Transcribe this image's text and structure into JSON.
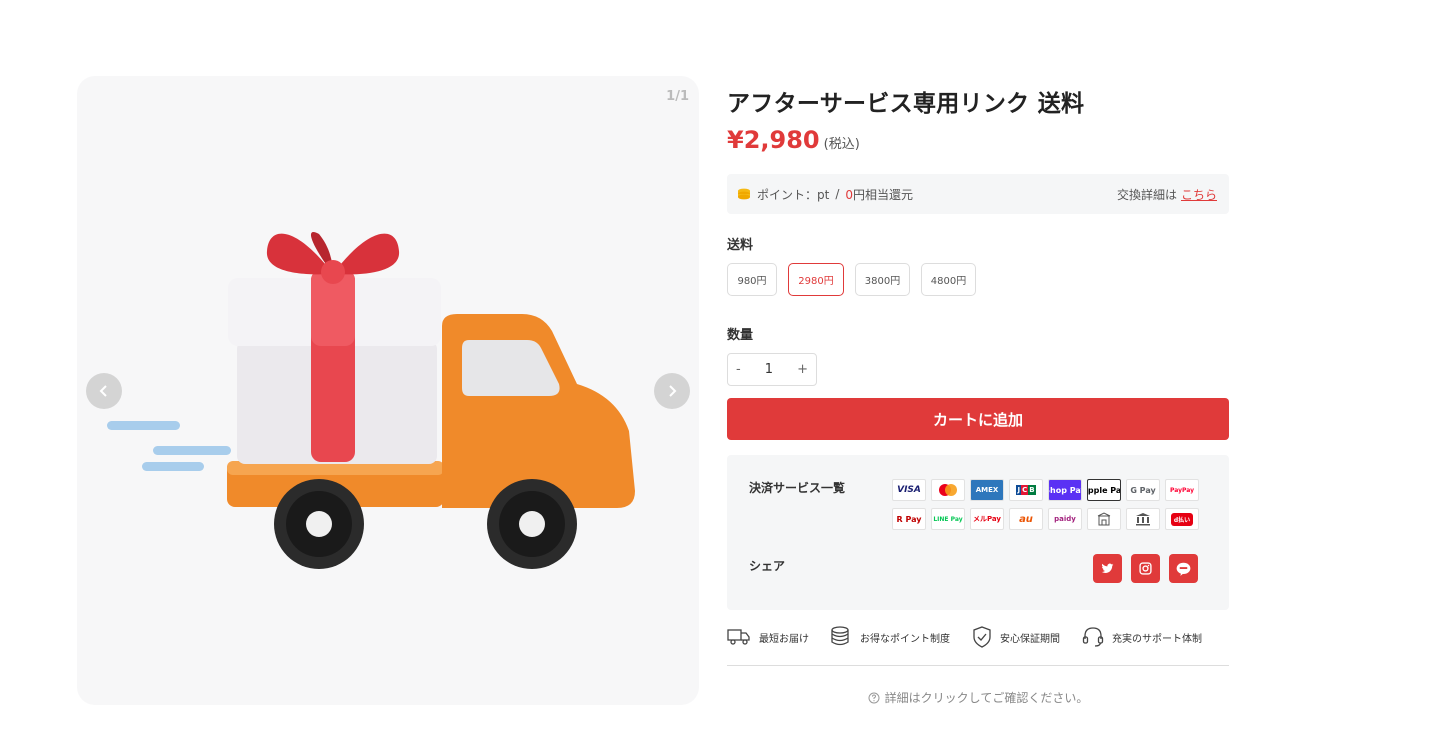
{
  "gallery": {
    "counter": "1/1",
    "image_alt": "gift-delivery-truck"
  },
  "product": {
    "title": "アフターサービス専用リンク 送料",
    "price": "¥2,980",
    "tax_note": "(税込)"
  },
  "points": {
    "label": "ポイント：pt",
    "separator": "/",
    "zero": "0",
    "suffix": "円相当還元",
    "exchange_label": "交換詳細は",
    "exchange_link": "こちら"
  },
  "shipping": {
    "label": "送料",
    "options": [
      "980円",
      "2980円",
      "3800円",
      "4800円"
    ],
    "selected": "2980円"
  },
  "quantity": {
    "label": "数量",
    "minus": "-",
    "value": "1",
    "plus": "+"
  },
  "cart_button": "カートに追加",
  "payments": {
    "label": "決済サービス一覧",
    "methods": [
      "VISA",
      "mastercard",
      "AMEX",
      "JCB",
      "Shop Pay",
      "Apple Pay",
      "G Pay",
      "PayPay",
      "R Pay",
      "LINE Pay",
      "メルPay",
      "au",
      "paidy",
      "コンビニ",
      "銀行振込",
      "d払い"
    ]
  },
  "share": {
    "label": "シェア",
    "icons": [
      "twitter",
      "instagram",
      "line"
    ]
  },
  "features": [
    "最短お届け",
    "お得なポイント制度",
    "安心保証期間",
    "充実のサポート体制"
  ],
  "details_note": "詳細はクリックしてご確認ください。",
  "colors": {
    "accent": "#e03a3a",
    "panel": "#f5f6f7",
    "gallery_bg": "#f7f7f8"
  }
}
